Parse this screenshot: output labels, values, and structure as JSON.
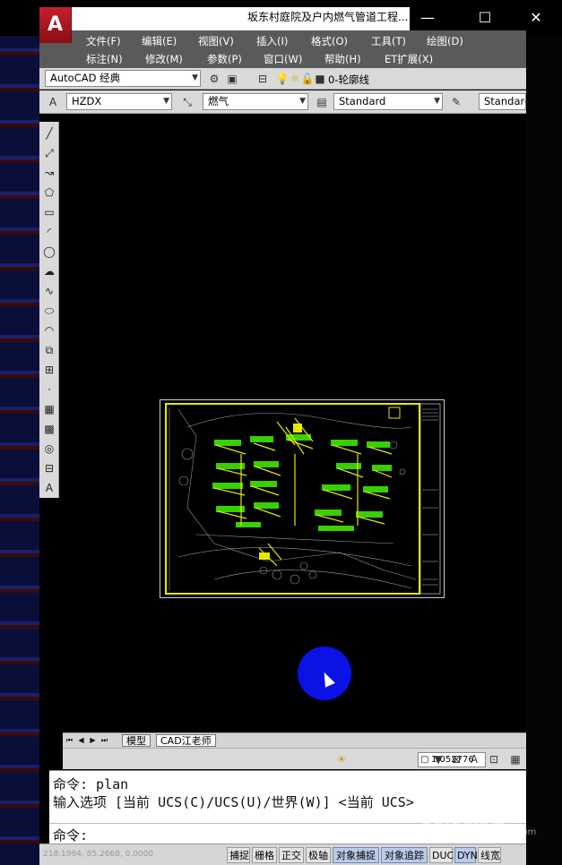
{
  "window": {
    "title": "坂东村庭院及户内燃气管道工程...",
    "app_logo": "A",
    "controls": [
      {
        "name": "minimize-icon",
        "glyph": "—"
      },
      {
        "name": "maximize-icon",
        "glyph": "☐"
      },
      {
        "name": "close-icon",
        "glyph": "✕"
      }
    ]
  },
  "menu": {
    "row1": [
      "文件(F)",
      "编辑(E)",
      "视图(V)",
      "插入(I)",
      "格式(O)",
      "工具(T)",
      "绘图(D)"
    ],
    "row2": [
      "标注(N)",
      "修改(M)",
      "参数(P)",
      "窗口(W)",
      "帮助(H)",
      "ET扩展(X)"
    ]
  },
  "toolbar1": {
    "workspace": "AutoCAD 经典",
    "layer": "0-轮廓线"
  },
  "toolbar2": {
    "text_style": "HZDX",
    "dim_style": "燃气",
    "table_style": "Standard",
    "multileader_style": "Standard"
  },
  "draw_tools": [
    {
      "name": "line-icon",
      "glyph": "╱"
    },
    {
      "name": "construction-line-icon",
      "glyph": "⤢"
    },
    {
      "name": "polyline-icon",
      "glyph": "↝"
    },
    {
      "name": "polygon-icon",
      "glyph": "⬠"
    },
    {
      "name": "rectangle-icon",
      "glyph": "▭"
    },
    {
      "name": "arc-icon",
      "glyph": "◜"
    },
    {
      "name": "circle-icon",
      "glyph": "◯"
    },
    {
      "name": "revision-cloud-icon",
      "glyph": "☁"
    },
    {
      "name": "spline-icon",
      "glyph": "∿"
    },
    {
      "name": "ellipse-icon",
      "glyph": "⬭"
    },
    {
      "name": "ellipse-arc-icon",
      "glyph": "◠"
    },
    {
      "name": "insert-block-icon",
      "glyph": "⧉"
    },
    {
      "name": "make-block-icon",
      "glyph": "⊞"
    },
    {
      "name": "point-icon",
      "glyph": "·"
    },
    {
      "name": "hatch-icon",
      "glyph": "▦"
    },
    {
      "name": "gradient-icon",
      "glyph": "▩"
    },
    {
      "name": "region-icon",
      "glyph": "◎"
    },
    {
      "name": "table-icon",
      "glyph": "⊟"
    },
    {
      "name": "multiline-text-icon",
      "glyph": "A"
    }
  ],
  "layout_tabs": {
    "tabs": [
      "模型",
      "CAD江老师"
    ]
  },
  "viewport": {
    "scale": "1.052776"
  },
  "command": {
    "line1": "命令: plan",
    "line2": "输入选项 [当前 UCS(C)/UCS(U)/世界(W)] <当前 UCS>",
    "prompt": "命令:"
  },
  "status": {
    "coords": "218.1994, 85.2668, 0.0000",
    "buttons": [
      {
        "label": "捕捉",
        "on": false
      },
      {
        "label": "栅格",
        "on": false
      },
      {
        "label": "正交",
        "on": false
      },
      {
        "label": "极轴",
        "on": false
      },
      {
        "label": "对象捕捉",
        "on": true
      },
      {
        "label": "对象追踪",
        "on": true
      },
      {
        "label": "DUCS",
        "on": false
      },
      {
        "label": "DYN",
        "on": true
      },
      {
        "label": "线宽",
        "on": false
      }
    ]
  },
  "watermark": {
    "main": "Baidu经验",
    "sub": "jingyan.baidu.com"
  },
  "colors": {
    "canvas": "#000000",
    "drawing_lines": "#e8e800",
    "drawing_green": "#39d000",
    "menubar": "#5a5a5a",
    "cursor_highlight": "#0a12e6"
  }
}
